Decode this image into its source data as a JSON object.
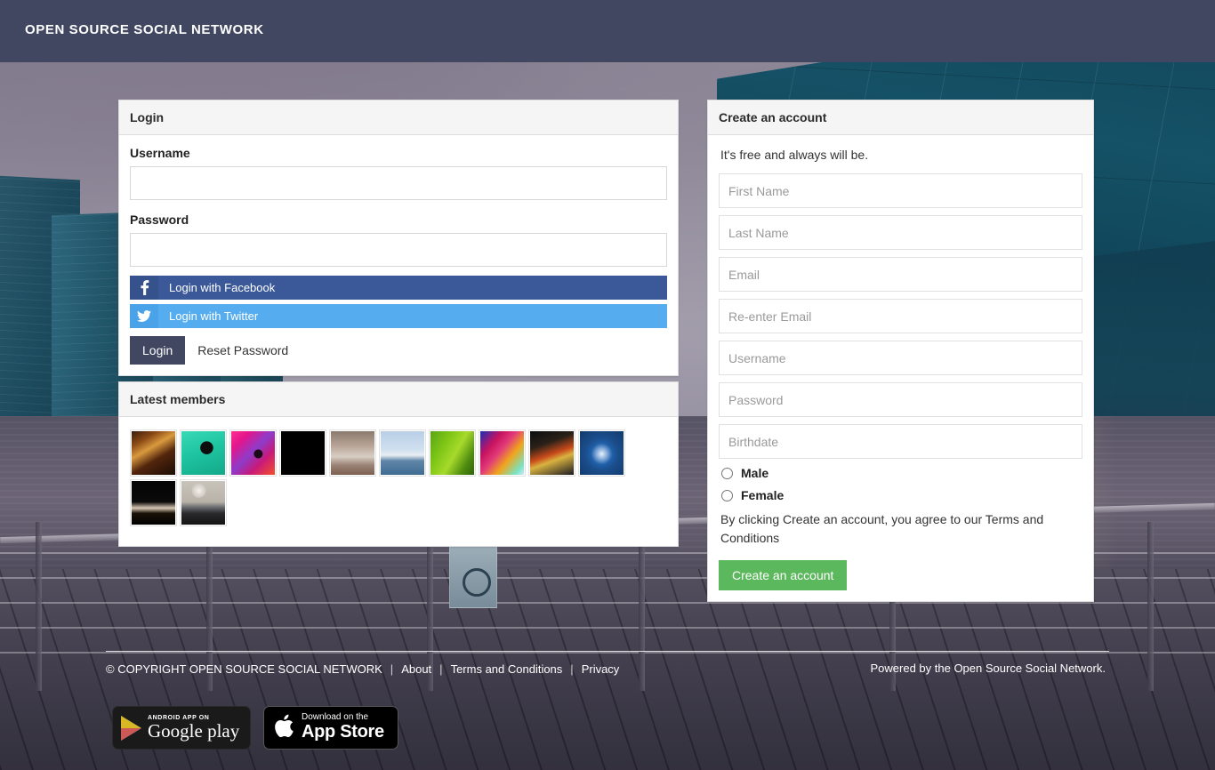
{
  "header": {
    "brand": "OPEN SOURCE SOCIAL NETWORK"
  },
  "login": {
    "title": "Login",
    "username_label": "Username",
    "username_value": "",
    "username_placeholder": "",
    "password_label": "Password",
    "password_value": "",
    "password_placeholder": "",
    "facebook_button": "Login with Facebook",
    "twitter_button": "Login with Twitter",
    "submit_button": "Login",
    "reset_link": "Reset Password",
    "facebook_color": "#3b5998",
    "twitter_color": "#55acee",
    "submit_color": "#414761"
  },
  "members": {
    "title": "Latest members",
    "count": 12,
    "thumbs": [
      {
        "name": "member-avatar-1",
        "css": "linear-gradient(150deg,#3a1c0c 0%,#8a4a16 22%,#d99a3e 40%,#53250d 62%,#1b0d05 100%)"
      },
      {
        "name": "member-avatar-2",
        "css": "radial-gradient(circle at 58% 38%, #0d0d0d 0%, #0d0d0d 17%, rgba(0,0,0,0) 18%), linear-gradient(160deg,#39d9b5 0%,#1fc5a2 45%,#13a889 100%)"
      },
      {
        "name": "member-avatar-3",
        "css": "radial-gradient(circle at 62% 52%, #1a0a18 0%, #1a0a18 12%, rgba(0,0,0,0) 13%), linear-gradient(135deg,#ff2f8f 0%,#e3168c 22%,#8e3bc9 48%,#c81a7a 70%,#f54f2b 100%)"
      },
      {
        "name": "member-avatar-4",
        "css": "#000000"
      },
      {
        "name": "member-avatar-5",
        "css": "linear-gradient(180deg,#8a7a6e 0%,#b9a597 34%,#d8cec4 58%,#9a8275 78%,#7c5f51 100%)"
      },
      {
        "name": "member-avatar-6",
        "css": "linear-gradient(180deg,#b9cfe6 0%,#cfe0ef 42%,#e9eef3 55%,#5f86a8 68%,#3f6b92 100%)"
      },
      {
        "name": "member-avatar-7",
        "css": "linear-gradient(120deg,#5aa516 0%,#7ec516 30%,#a7da2b 55%,#4f8c0f 80%,#2f6308 100%)"
      },
      {
        "name": "member-avatar-8",
        "css": "linear-gradient(130deg,#1b2fb5 0%,#c8135f 28%,#e23a7a 45%,#f0a51c 65%,#79e3c1 88%,#cfe9ff 100%)"
      },
      {
        "name": "member-avatar-9",
        "css": "linear-gradient(160deg,#0c0c10 0%,#2a2118 30%,#c84a1a 52%,#d9b23f 64%,#1a1a22 100%)"
      },
      {
        "name": "member-avatar-10",
        "css": "radial-gradient(circle at 50% 52%, #e9f2fb 0%, #7fa8d8 18%, #1f5fa8 34%, #1b4e8c 52%, #123a6b 100%)"
      },
      {
        "name": "member-avatar-11",
        "css": "linear-gradient(180deg,#050505 0%,#0a0a0a 48%,#d9c8b4 62%,#1a1208 74%,#000000 100%)"
      },
      {
        "name": "member-avatar-12",
        "css": "radial-gradient(circle at 40% 22%, #f4f2ec 0%, #cfc9c0 16%, rgba(0,0,0,0) 17%), linear-gradient(180deg,#c9c4bb 0%,#b8b2a8 48%,#6a6c70 60%,#2a2a2c 74%,#131314 100%)"
      }
    ]
  },
  "register": {
    "title": "Create an account",
    "subtitle": "It's free and always will be.",
    "fields": [
      {
        "name": "first-name-field",
        "placeholder": "First Name",
        "value": "",
        "type": "text"
      },
      {
        "name": "last-name-field",
        "placeholder": "Last Name",
        "value": "",
        "type": "text"
      },
      {
        "name": "email-field",
        "placeholder": "Email",
        "value": "",
        "type": "text"
      },
      {
        "name": "reenter-email-field",
        "placeholder": "Re-enter Email",
        "value": "",
        "type": "text"
      },
      {
        "name": "username-field",
        "placeholder": "Username",
        "value": "",
        "type": "text"
      },
      {
        "name": "password-field",
        "placeholder": "Password",
        "value": "",
        "type": "password"
      },
      {
        "name": "birthdate-field",
        "placeholder": "Birthdate",
        "value": "",
        "type": "text"
      }
    ],
    "gender": {
      "male_label": "Male",
      "female_label": "Female",
      "selected": ""
    },
    "terms_text": "By clicking Create an account, you agree to our Terms and Conditions",
    "submit_button": "Create an account",
    "submit_color": "#5cb85c"
  },
  "footer": {
    "copyright": "© COPYRIGHT OPEN SOURCE SOCIAL NETWORK",
    "separator": "|",
    "link_about": "About",
    "link_terms": "Terms and Conditions",
    "link_privacy": "Privacy",
    "powered_prefix": "Powered by ",
    "powered_link": "the Open Source Social Network",
    "powered_suffix": ".",
    "google_play": {
      "small": "ANDROID APP ON",
      "big": "Google play"
    },
    "app_store": {
      "small": "Download on the",
      "big": "App Store"
    }
  }
}
